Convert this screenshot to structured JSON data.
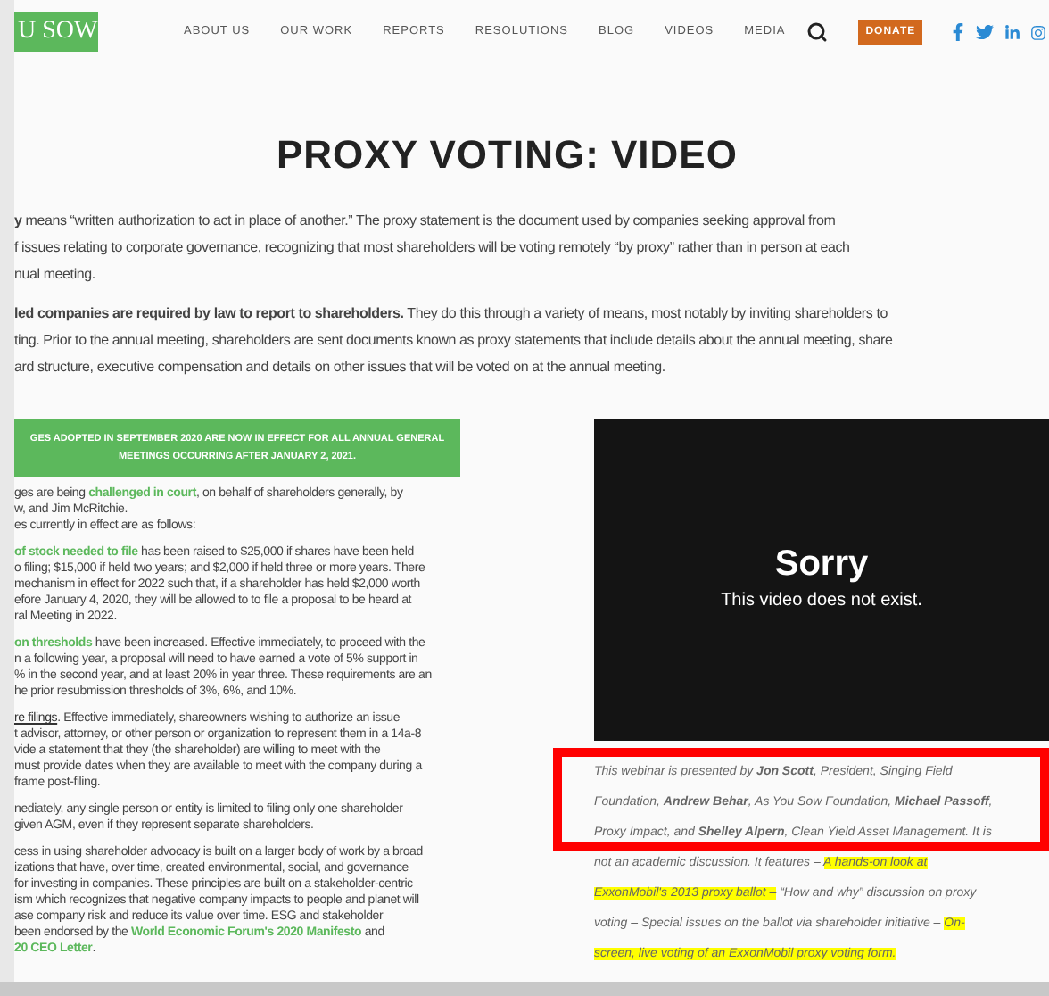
{
  "header": {
    "logo": "U SOW",
    "nav": [
      "ABOUT US",
      "OUR WORK",
      "REPORTS",
      "RESOLUTIONS",
      "BLOG",
      "VIDEOS",
      "MEDIA"
    ],
    "donate": "DONATE"
  },
  "title": "PROXY VOTING: VIDEO",
  "intro": [
    [
      "**y** means “written authorization to act in place of another.” The proxy statement is the document used by companies seeking approval from",
      "f issues relating to corporate governance, recognizing that most shareholders will be voting remotely “by proxy” rather than in person at each",
      "nual meeting."
    ],
    [
      "**led companies are required by law to report to shareholders.** They do this through a variety of means, most notably by inviting shareholders to",
      "ting. Prior to the annual meeting, shareholders are sent documents known as proxy statements that include details about the annual meeting, share",
      "ard structure, executive compensation and details on other issues that will be voted on at the annual meeting."
    ]
  ],
  "banner": [
    "GES ADOPTED IN SEPTEMBER 2020 ARE NOW IN EFFECT FOR ALL ANNUAL GENERAL",
    "MEETINGS OCCURRING AFTER JANUARY 2, 2021."
  ],
  "left_paragraphs": [
    [
      [
        {
          "kind": "text",
          "text": "ges are being "
        },
        {
          "kind": "link",
          "text": "challenged in court"
        },
        {
          "kind": "text",
          "text": ", on behalf of shareholders generally, by"
        }
      ],
      [
        {
          "kind": "text",
          "text": "w, and Jim McRitchie."
        }
      ],
      [
        {
          "kind": "text",
          "text": "es currently in effect are as follows:"
        }
      ]
    ],
    [
      [
        {
          "kind": "link",
          "text": "of stock needed to file"
        },
        {
          "kind": "text",
          "text": " has been raised to $25,000 if shares have been held"
        }
      ],
      [
        {
          "kind": "text",
          "text": "o filing; $15,000 if held two years; and $2,000 if held three or more years. There"
        }
      ],
      [
        {
          "kind": "text",
          "text": "mechanism in effect for 2022 such that, if a shareholder has held $2,000 worth"
        }
      ],
      [
        {
          "kind": "text",
          "text": "efore January 4, 2020, they will be allowed to to file a proposal to be heard at"
        }
      ],
      [
        {
          "kind": "text",
          "text": "ral Meeting in 2022."
        }
      ]
    ],
    [
      [
        {
          "kind": "link",
          "text": "on thresholds"
        },
        {
          "kind": "text",
          "text": " have been increased. Effective immediately, to proceed with the"
        }
      ],
      [
        {
          "kind": "text",
          "text": "n a following year, a proposal will need to have earned a vote of 5% support in"
        }
      ],
      [
        {
          "kind": "text",
          "text": "% in the second year, and at least 20% in year three. These requirements are an"
        }
      ],
      [
        {
          "kind": "text",
          "text": "he prior resubmission thresholds of 3%, 6%, and 10%."
        }
      ]
    ],
    [
      [
        {
          "kind": "underline",
          "text": "re filings"
        },
        {
          "kind": "text",
          "text": ". Effective immediately, shareowners wishing to authorize an issue"
        }
      ],
      [
        {
          "kind": "text",
          "text": "t advisor, attorney, or other person or organization to represent them in a 14a-8"
        }
      ],
      [
        {
          "kind": "text",
          "text": "vide a statement that they (the shareholder) are willing to meet with the"
        }
      ],
      [
        {
          "kind": "text",
          "text": "must provide dates when they are available to meet with the company during a"
        }
      ],
      [
        {
          "kind": "text",
          "text": "frame post-filing."
        }
      ]
    ],
    [
      [
        {
          "kind": "text",
          "text": "nediately, any single person or entity is limited to filing only one shareholder"
        }
      ],
      [
        {
          "kind": "text",
          "text": "given AGM, even if they represent separate shareholders."
        }
      ]
    ],
    [
      [
        {
          "kind": "text",
          "text": "cess in using shareholder advocacy is built on a larger body of work by a broad"
        }
      ],
      [
        {
          "kind": "text",
          "text": "izations that have, over time, created environmental, social, and governance"
        }
      ],
      [
        {
          "kind": "text",
          "text": "for investing in companies. These principles are built on a stakeholder-centric"
        }
      ],
      [
        {
          "kind": "text",
          "text": "ism which recognizes that negative company impacts to people and planet will"
        }
      ],
      [
        {
          "kind": "text",
          "text": "ase company risk and reduce its value over time. ESG and stakeholder"
        }
      ],
      [
        {
          "kind": "text",
          "text": "been endorsed by the "
        },
        {
          "kind": "link",
          "text": "World Economic Forum's 2020 Manifesto"
        },
        {
          "kind": "text",
          "text": " and"
        }
      ],
      [
        {
          "kind": "link",
          "text": "20 CEO Letter"
        },
        {
          "kind": "text",
          "text": "."
        }
      ]
    ]
  ],
  "video": {
    "heading": "Sorry",
    "message": "This video does not exist."
  },
  "webinar_lines": [
    [
      {
        "kind": "text",
        "text": "This webinar is presented by **Jon Scott**, President, Singing Field"
      }
    ],
    [
      {
        "kind": "text",
        "text": "Foundation, **Andrew Behar**, As You Sow Foundation, **Michael Passoff**,"
      }
    ],
    [
      {
        "kind": "text",
        "text": "Proxy Impact, and **Shelley Alpern**, Clean Yield Asset Management. It is"
      }
    ],
    [
      {
        "kind": "text",
        "text": "not an academic discussion. It features – "
      },
      {
        "kind": "highlight",
        "text": "A hands-on look at"
      }
    ],
    [
      {
        "kind": "highlight",
        "text": "ExxonMobil's 2013 proxy ballot –"
      },
      {
        "kind": "text",
        "text": " “How and why” discussion on proxy"
      }
    ],
    [
      {
        "kind": "text",
        "text": "voting – Special issues on the ballot via shareholder initiative – "
      },
      {
        "kind": "highlight",
        "text": "On-"
      }
    ],
    [
      {
        "kind": "highlight",
        "text": "screen, live voting of an ExxonMobil proxy voting form."
      }
    ]
  ]
}
